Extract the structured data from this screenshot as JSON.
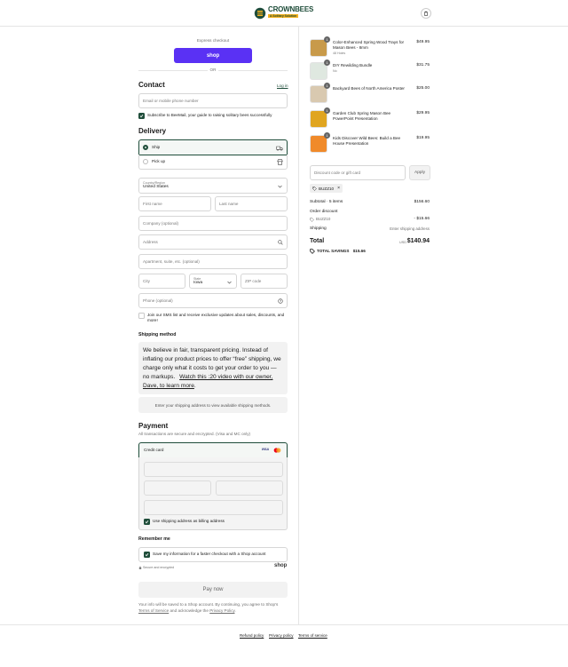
{
  "brand": {
    "name": "CROWNBEES",
    "tagline": "A Solitary Solution",
    "green": "#1f4d3a",
    "yellow": "#f3b11d"
  },
  "express": {
    "label": "Express checkout",
    "shop_button": "shop",
    "or": "OR"
  },
  "contact": {
    "title": "Contact",
    "login": "Log in",
    "email_placeholder": "Email or mobile phone number",
    "subscribe": "Subscribe to BeeMail, your guide to raising solitary bees successfully"
  },
  "delivery": {
    "title": "Delivery",
    "ship": "Ship",
    "pickup": "Pick up",
    "country_label": "Country/Region",
    "country_value": "United States",
    "first_name": "First name",
    "last_name": "Last name",
    "company": "Company (optional)",
    "address": "Address",
    "apartment": "Apartment, suite, etc. (optional)",
    "city": "City",
    "state_label": "State",
    "state_value": "Iowa",
    "zip": "ZIP code",
    "phone": "Phone (optional)",
    "sms": "Join our SMS list and receive exclusive updates about sales, discounts, and more!"
  },
  "shipping_method": {
    "title": "Shipping method",
    "message": "We believe in fair, transparent pricing. Instead of inflating our product prices to offer “free” shipping, we charge only what it costs to get your order to you — no markups.",
    "video_link": "Watch this :20 video with our owner, Dave, to learn more",
    "video_end": ".",
    "notice": "Enter your shipping address to view available shipping methods."
  },
  "payment": {
    "title": "Payment",
    "subtitle": "All transactions are secure and encrypted. (Visa and MC only)",
    "credit_card": "Credit card",
    "visa": "VISA",
    "billing": "Use shipping address as billing address"
  },
  "remember": {
    "title": "Remember me",
    "save": "Save my information for a faster checkout with a Shop account",
    "secure": "Secure and encrypted",
    "shop": "shop"
  },
  "pay_now": "Pay now",
  "legal": {
    "prefix": "Your info will be saved to a Shop account. By continuing, you agree to Shop’s",
    "tos": "Terms of Service",
    "mid": "and acknowledge the",
    "privacy": "Privacy Policy",
    "end": "."
  },
  "cart": {
    "items": [
      {
        "name": "Color-Enhanced Spring Wood Trays for Mason Bees - 8mm",
        "sub": "48 Holes",
        "price": "$49.95",
        "qty": "1",
        "thumb_color": "#c89a4a"
      },
      {
        "name": "DIY Rewilding Bundle",
        "sub": "No",
        "price": "$31.75",
        "qty": "1",
        "thumb_color": "#dfe8e0"
      },
      {
        "name": "Backyard Bees of North America Poster",
        "sub": "",
        "price": "$25.00",
        "qty": "1",
        "thumb_color": "#d9c9b0"
      },
      {
        "name": "Garden Club Spring Mason Bee PowerPoint Presentation",
        "sub": "",
        "price": "$29.95",
        "qty": "1",
        "thumb_color": "#e0a520"
      },
      {
        "name": "Kids Discover Wild Bees: Build a Bee House Presentation",
        "sub": "",
        "price": "$19.95",
        "qty": "1",
        "thumb_color": "#f08a2a"
      }
    ],
    "discount_placeholder": "Discount code or gift card",
    "apply": "Apply",
    "code_tag": "BUZZ10",
    "subtotal_label": "Subtotal · 5 items",
    "subtotal_value": "$156.60",
    "order_discount": "Order discount",
    "code_line": "BUZZ10",
    "discount_value": "- $15.66",
    "shipping_label": "Shipping",
    "shipping_value": "Enter shipping address",
    "total_label": "Total",
    "currency": "USD",
    "total_value": "$140.94",
    "savings_label": "TOTAL SAVINGS",
    "savings_value": "$15.66"
  },
  "footer": {
    "refund": "Refund policy",
    "privacy": "Privacy policy",
    "terms": "Terms of service"
  }
}
